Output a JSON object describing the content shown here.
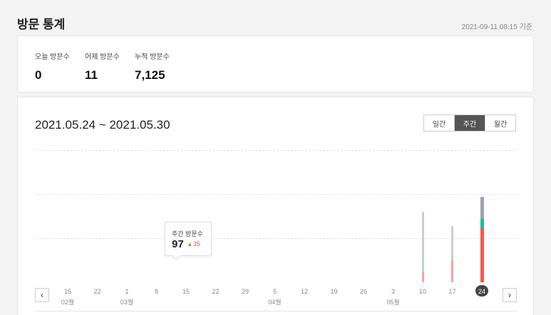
{
  "page": {
    "title": "방문 통계",
    "timestamp": "2021-09-11 08:15 기준"
  },
  "stats": [
    {
      "label": "오늘 방문수",
      "value": "0"
    },
    {
      "label": "어제 방문수",
      "value": "11"
    },
    {
      "label": "누적 방문수",
      "value": "7,125"
    }
  ],
  "chart_header": {
    "range": "2021.05.24 ~ 2021.05.30",
    "periods": [
      "일간",
      "주간",
      "월간"
    ],
    "active_period": "주간"
  },
  "tooltip": {
    "label": "주간 방문수",
    "value": "97",
    "delta": "35",
    "delta_icon": "up-triangle-icon"
  },
  "nav": {
    "prev_icon": "chevron-left-icon",
    "next_icon": "chevron-right-icon"
  },
  "colors": {
    "gray": "#9aa4ae",
    "teal": "#16c0a6",
    "red": "#f55a4e",
    "light_red": "#f4a49c",
    "badge": "#444444"
  },
  "chart_data": {
    "type": "bar",
    "stacked": true,
    "categories": [
      "15",
      "22",
      "1",
      "8",
      "15",
      "22",
      "29",
      "5",
      "12",
      "19",
      "26",
      "3",
      "10",
      "17",
      "24"
    ],
    "month_labels": [
      "02월",
      "",
      "03월",
      "",
      "",
      "",
      "",
      "04월",
      "",
      "",
      "",
      "05월",
      "",
      "",
      ""
    ],
    "selected_category": "24",
    "ylim": [
      0,
      100
    ],
    "grid": true,
    "series": [
      {
        "color": "#f55a4e",
        "values": [
          0,
          0,
          0,
          0,
          0,
          0,
          0,
          0,
          0,
          0,
          0,
          0,
          12,
          26,
          62
        ]
      },
      {
        "color": "#16c0a6",
        "values": [
          0,
          0,
          0,
          0,
          0,
          0,
          0,
          0,
          0,
          0,
          0,
          0,
          2,
          4,
          10
        ]
      },
      {
        "color": "#9aa4ae",
        "values": [
          0,
          0,
          0,
          0,
          0,
          0,
          0,
          0,
          0,
          0,
          0,
          0,
          66,
          34,
          25
        ]
      }
    ]
  }
}
